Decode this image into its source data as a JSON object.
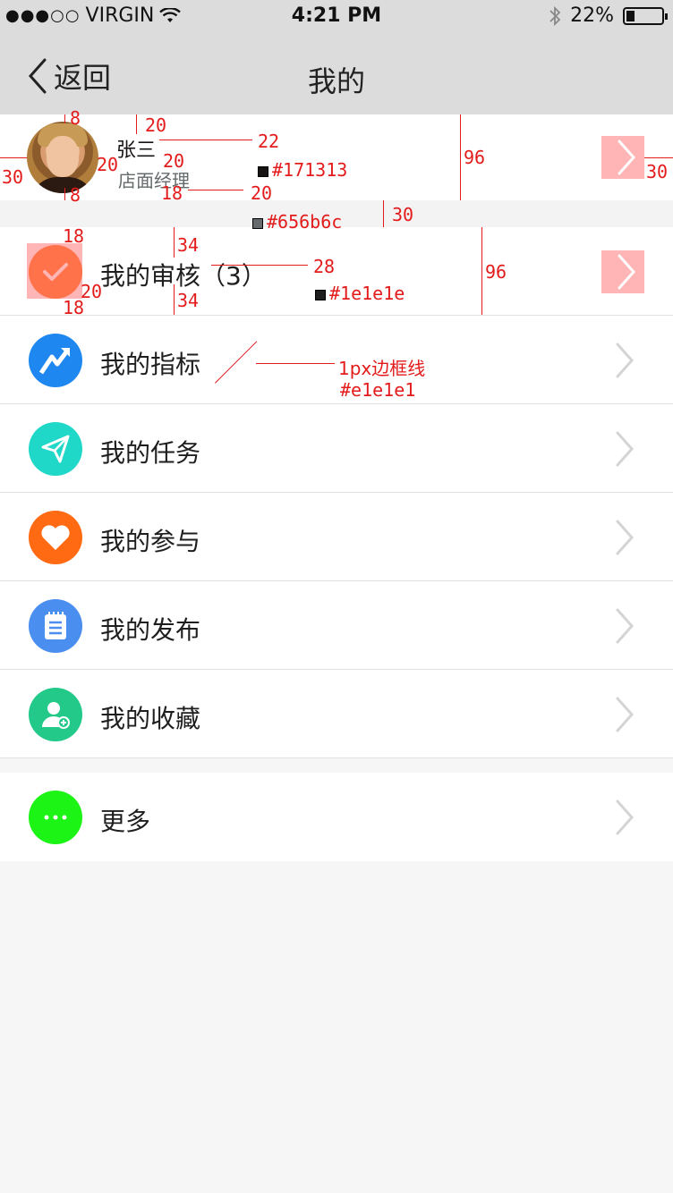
{
  "status_bar": {
    "signal": "●●●○○",
    "carrier": "VIRGIN",
    "time": "4:21 PM",
    "battery": "22%"
  },
  "nav": {
    "back_label": "返回",
    "title": "我的"
  },
  "profile": {
    "name": "张三",
    "role": "店面经理"
  },
  "menu": [
    {
      "label": "我的审核（3）",
      "icon": "check-icon",
      "color": "#ff6a13"
    },
    {
      "label": "我的指标",
      "icon": "trend-up-icon",
      "color": "#1e88f0"
    },
    {
      "label": "我的任务",
      "icon": "paper-plane-icon",
      "color": "#1fd8c7"
    },
    {
      "label": "我的参与",
      "icon": "heart-icon",
      "color": "#ff6a13"
    },
    {
      "label": "我的发布",
      "icon": "notepad-icon",
      "color": "#4a8ef0"
    },
    {
      "label": "我的收藏",
      "icon": "user-add-icon",
      "color": "#22c989"
    }
  ],
  "more": {
    "label": "更多",
    "icon": "ellipsis-icon",
    "color": "#1bf415"
  },
  "annotations": {
    "n8a": "8",
    "n20a": "20",
    "n30a": "30",
    "n20b": "20",
    "n22": "22",
    "c171313": "#171313",
    "n20c": "20",
    "n8b": "8",
    "n18a": "18",
    "n20d": "20",
    "n96a": "96",
    "n30b": "30",
    "c656b6c": "#656b6c",
    "n30c": "30",
    "n18b": "18",
    "n34a": "34",
    "n28": "28",
    "n96b": "96",
    "n20e": "20",
    "c1e1e1e": "#1e1e1e",
    "n18c": "18",
    "n34b": "34",
    "border_note": "1px边框线",
    "border_color": "#e1e1e1"
  },
  "colors": {
    "nav_bg": "#dcdcdc",
    "name_text": "#171313",
    "role_text": "#656b6c",
    "label_text": "#1e1e1e",
    "border": "#e1e1e1",
    "annotation": "#e31b1b"
  }
}
